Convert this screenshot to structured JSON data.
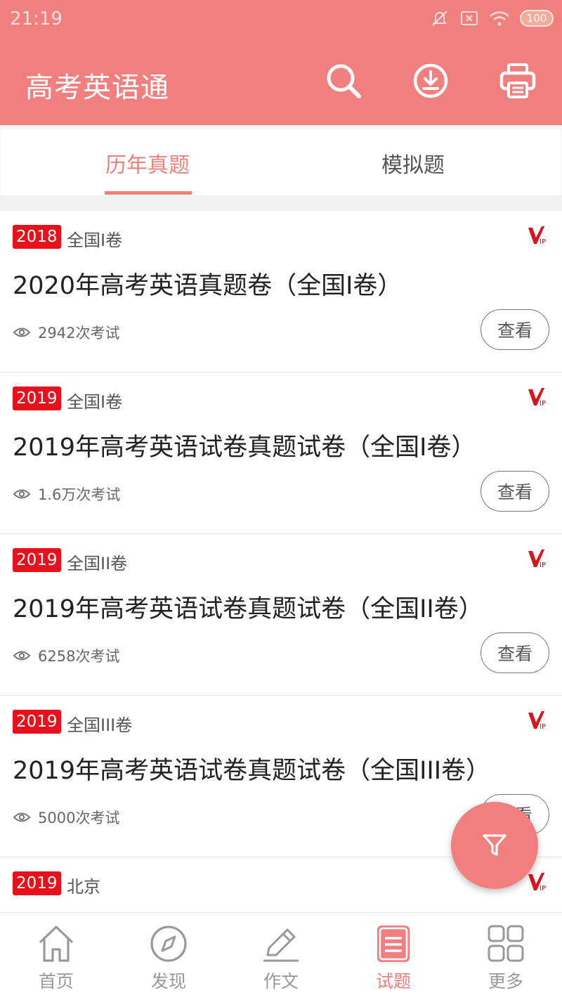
{
  "status_bar": {
    "time": "21:19",
    "battery": "100"
  },
  "header": {
    "title": "高考英语通",
    "icons": [
      "search-icon",
      "download-icon",
      "print-icon"
    ]
  },
  "tabs": [
    {
      "label": "历年真题",
      "active": true
    },
    {
      "label": "模拟题",
      "active": false
    }
  ],
  "papers": [
    {
      "year": "2018",
      "type": "全国I卷",
      "title": "2020年高考英语真题卷（全国I卷）",
      "views": "2942次考试",
      "action": "查看"
    },
    {
      "year": "2019",
      "type": "全国I卷",
      "title": "2019年高考英语试卷真题试卷（全国I卷）",
      "views": "1.6万次考试",
      "action": "查看"
    },
    {
      "year": "2019",
      "type": "全国II卷",
      "title": "2019年高考英语试卷真题试卷（全国II卷）",
      "views": "6258次考试",
      "action": "查看"
    },
    {
      "year": "2019",
      "type": "全国III卷",
      "title": "2019年高考英语试卷真题试卷（全国III卷）",
      "views": "5000次考试",
      "action": "查看"
    },
    {
      "year": "2019",
      "type": "北京"
    }
  ],
  "bottom_nav": [
    {
      "label": "首页",
      "icon": "home-icon",
      "active": false
    },
    {
      "label": "发现",
      "icon": "compass-icon",
      "active": false
    },
    {
      "label": "作文",
      "icon": "pencil-icon",
      "active": false
    },
    {
      "label": "试题",
      "icon": "exam-list-icon",
      "active": true
    },
    {
      "label": "更多",
      "icon": "grid-icon",
      "active": false
    }
  ],
  "colors": {
    "primary": "#f07f7e",
    "badge": "#e8101a",
    "vip": "#d8141c"
  }
}
